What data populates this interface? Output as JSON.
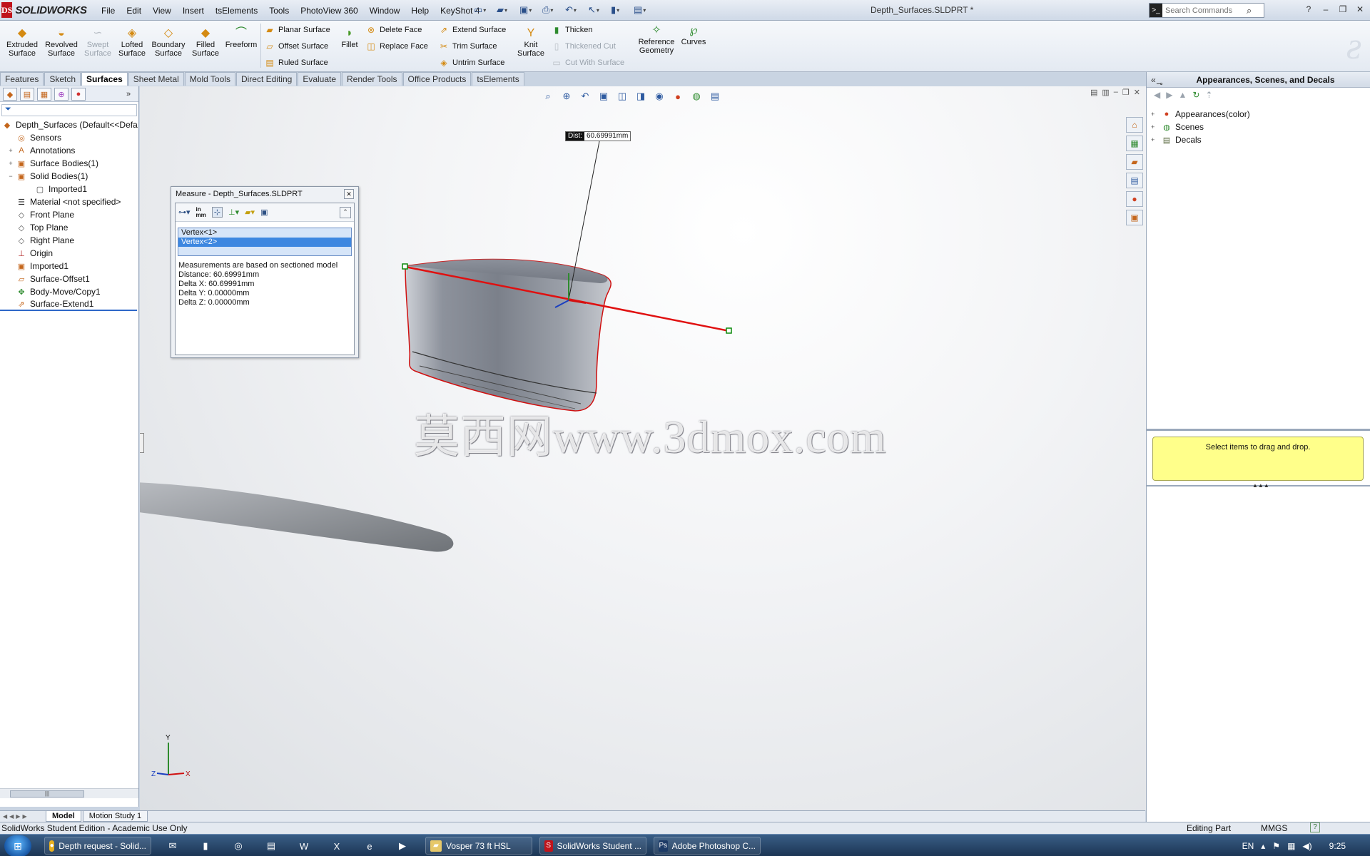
{
  "app": {
    "logo": "SOLIDWORKS",
    "document_title": "Depth_Surfaces.SLDPRT *"
  },
  "menu": [
    "File",
    "Edit",
    "View",
    "Insert",
    "tsElements",
    "Tools",
    "PhotoView 360",
    "Window",
    "Help",
    "KeyShot 4"
  ],
  "search": {
    "placeholder": "Search Commands"
  },
  "commands": {
    "extruded": "Extruded\nSurface",
    "revolved": "Revolved\nSurface",
    "swept": "Swept\nSurface",
    "lofted": "Lofted\nSurface",
    "boundary": "Boundary\nSurface",
    "filled": "Filled\nSurface",
    "freeform": "Freeform",
    "planar": "Planar Surface",
    "offset": "Offset Surface",
    "ruled": "Ruled Surface",
    "fillet": "Fillet",
    "delete_face": "Delete Face",
    "replace_face": "Replace Face",
    "extend": "Extend Surface",
    "trim": "Trim Surface",
    "untrim": "Untrim Surface",
    "knit": "Knit\nSurface",
    "thicken": "Thicken",
    "thickened_cut": "Thickened Cut",
    "cut_with_surface": "Cut With Surface",
    "reference_geometry": "Reference\nGeometry",
    "curves": "Curves"
  },
  "tabs": [
    "Features",
    "Sketch",
    "Surfaces",
    "Sheet Metal",
    "Mold Tools",
    "Direct Editing",
    "Evaluate",
    "Render Tools",
    "Office Products",
    "tsElements"
  ],
  "active_tab": "Surfaces",
  "feature_tree": {
    "root": "Depth_Surfaces  (Default<<Defa",
    "items": [
      {
        "label": "Sensors",
        "icon": "sensor-icon",
        "expand": ""
      },
      {
        "label": "Annotations",
        "icon": "annotation-icon",
        "expand": "+"
      },
      {
        "label": "Surface Bodies(1)",
        "icon": "surface-bodies-icon",
        "expand": "+"
      },
      {
        "label": "Solid Bodies(1)",
        "icon": "solid-bodies-icon",
        "expand": "−"
      },
      {
        "label": "Imported1",
        "icon": "body-icon",
        "expand": "",
        "indent": true
      },
      {
        "label": "Material <not specified>",
        "icon": "material-icon",
        "expand": ""
      },
      {
        "label": "Front Plane",
        "icon": "plane-icon",
        "expand": ""
      },
      {
        "label": "Top Plane",
        "icon": "plane-icon",
        "expand": ""
      },
      {
        "label": "Right Plane",
        "icon": "plane-icon",
        "expand": ""
      },
      {
        "label": "Origin",
        "icon": "origin-icon",
        "expand": ""
      },
      {
        "label": "Imported1",
        "icon": "imported-icon",
        "expand": ""
      },
      {
        "label": "Surface-Offset1",
        "icon": "offset-surface-icon",
        "expand": ""
      },
      {
        "label": "Body-Move/Copy1",
        "icon": "move-copy-icon",
        "expand": ""
      },
      {
        "label": "Surface-Extend1",
        "icon": "extend-surface-icon",
        "expand": ""
      }
    ]
  },
  "bottom_tabs": [
    "Model",
    "Motion Study 1"
  ],
  "measure": {
    "title": "Measure - Depth_Surfaces.SLDPRT",
    "units_label": "in\nmm",
    "selections": [
      "Vertex<1>",
      "Vertex<2>"
    ],
    "results": [
      "Measurements are based on sectioned model",
      "Distance: 60.69991mm",
      "Delta X: 60.69991mm",
      "Delta Y: 0.00000mm",
      "Delta Z: 0.00000mm"
    ]
  },
  "dist_callout": {
    "key": "Dist:",
    "value": "60.69991mm"
  },
  "watermark": "莫西网www.3dmox.com",
  "triad": {
    "x": "X",
    "y": "Y",
    "z": "Z"
  },
  "right_panel": {
    "title": "Appearances, Scenes, and Decals",
    "items": [
      {
        "label": "Appearances(color)",
        "icon": "appearances-icon"
      },
      {
        "label": "Scenes",
        "icon": "scenes-icon"
      },
      {
        "label": "Decals",
        "icon": "decals-icon"
      }
    ],
    "drag_hint": "Select items to drag and drop."
  },
  "status": {
    "left": "SolidWorks Student Edition - Academic Use Only",
    "mode": "Editing Part",
    "units": "MMGS"
  },
  "taskbar": {
    "windows": [
      "Depth request - Solid...",
      "Vosper 73 ft HSL",
      "SolidWorks Student ...",
      "Adobe Photoshop C..."
    ],
    "lang": "EN",
    "clock": "9:25"
  },
  "colors": {
    "accent": "#3d87e0",
    "measure_line": "#e01010",
    "dragdrop_bg": "#ffff8a"
  }
}
